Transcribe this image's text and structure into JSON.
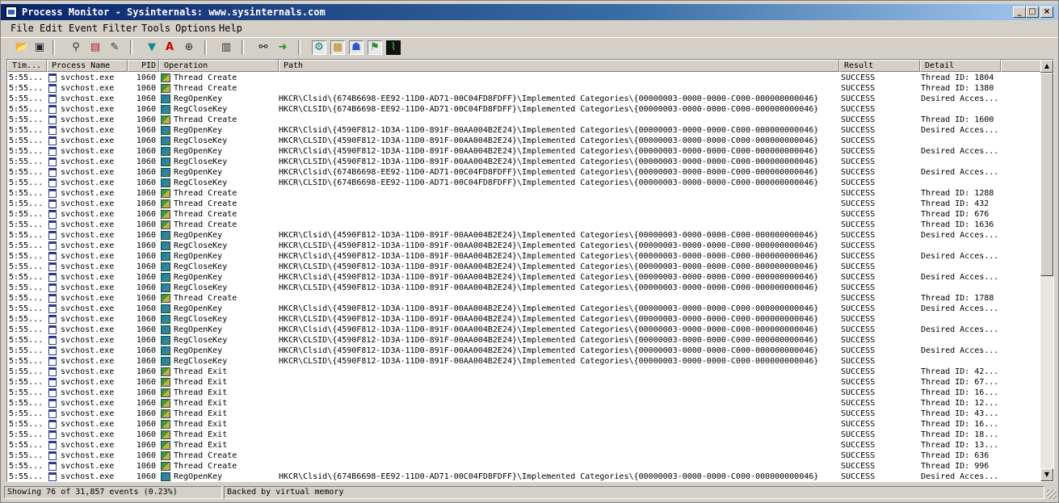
{
  "window": {
    "title": "Process Monitor - Sysinternals: www.sysinternals.com"
  },
  "menu": [
    "File",
    "Edit",
    "Event",
    "Filter",
    "Tools",
    "Options",
    "Help"
  ],
  "toolbar": {
    "icons": [
      "open-icon",
      "save-icon",
      "magnifier-icon",
      "autoscroll-icon",
      "clear-icon",
      "filter-icon",
      "highlight-icon",
      "target-icon",
      "properties-icon",
      "find-icon",
      "jump-icon",
      "show-registry-icon",
      "show-filesystem-icon",
      "show-network-icon",
      "show-process-icon",
      "show-profiling-icon"
    ]
  },
  "columns": [
    "Tim...",
    "Process Name",
    "PID",
    "Operation",
    "Path",
    "Result",
    "Detail"
  ],
  "rows": [
    {
      "time": "5:55...",
      "proc": "svchost.exe",
      "pid": "1060",
      "type": "thr",
      "op": "Thread Create",
      "path": "",
      "result": "SUCCESS",
      "detail": "Thread ID: 1804"
    },
    {
      "time": "5:55...",
      "proc": "svchost.exe",
      "pid": "1060",
      "type": "thr",
      "op": "Thread Create",
      "path": "",
      "result": "SUCCESS",
      "detail": "Thread ID: 1380"
    },
    {
      "time": "5:55...",
      "proc": "svchost.exe",
      "pid": "1060",
      "type": "reg",
      "op": "RegOpenKey",
      "path": "HKCR\\Clsid\\{674B6698-EE92-11D0-AD71-00C04FD8FDFF}\\Implemented Categories\\{00000003-0000-0000-C000-000000000046}",
      "result": "SUCCESS",
      "detail": "Desired Acces..."
    },
    {
      "time": "5:55...",
      "proc": "svchost.exe",
      "pid": "1060",
      "type": "reg",
      "op": "RegCloseKey",
      "path": "HKCR\\CLSID\\{674B6698-EE92-11D0-AD71-00C04FD8FDFF}\\Implemented Categories\\{00000003-0000-0000-C000-000000000046}",
      "result": "SUCCESS",
      "detail": ""
    },
    {
      "time": "5:55...",
      "proc": "svchost.exe",
      "pid": "1060",
      "type": "thr",
      "op": "Thread Create",
      "path": "",
      "result": "SUCCESS",
      "detail": "Thread ID: 1600"
    },
    {
      "time": "5:55...",
      "proc": "svchost.exe",
      "pid": "1060",
      "type": "reg",
      "op": "RegOpenKey",
      "path": "HKCR\\Clsid\\{4590F812-1D3A-11D0-891F-00AA004B2E24}\\Implemented Categories\\{00000003-0000-0000-C000-000000000046}",
      "result": "SUCCESS",
      "detail": "Desired Acces..."
    },
    {
      "time": "5:55...",
      "proc": "svchost.exe",
      "pid": "1060",
      "type": "reg",
      "op": "RegCloseKey",
      "path": "HKCR\\CLSID\\{4590F812-1D3A-11D0-891F-00AA004B2E24}\\Implemented Categories\\{00000003-0000-0000-C000-000000000046}",
      "result": "SUCCESS",
      "detail": ""
    },
    {
      "time": "5:55...",
      "proc": "svchost.exe",
      "pid": "1060",
      "type": "reg",
      "op": "RegOpenKey",
      "path": "HKCR\\Clsid\\{4590F812-1D3A-11D0-891F-00AA004B2E24}\\Implemented Categories\\{00000003-0000-0000-C000-000000000046}",
      "result": "SUCCESS",
      "detail": "Desired Acces..."
    },
    {
      "time": "5:55...",
      "proc": "svchost.exe",
      "pid": "1060",
      "type": "reg",
      "op": "RegCloseKey",
      "path": "HKCR\\CLSID\\{4590F812-1D3A-11D0-891F-00AA004B2E24}\\Implemented Categories\\{00000003-0000-0000-C000-000000000046}",
      "result": "SUCCESS",
      "detail": ""
    },
    {
      "time": "5:55...",
      "proc": "svchost.exe",
      "pid": "1060",
      "type": "reg",
      "op": "RegOpenKey",
      "path": "HKCR\\Clsid\\{674B6698-EE92-11D0-AD71-00C04FD8FDFF}\\Implemented Categories\\{00000003-0000-0000-C000-000000000046}",
      "result": "SUCCESS",
      "detail": "Desired Acces..."
    },
    {
      "time": "5:55...",
      "proc": "svchost.exe",
      "pid": "1060",
      "type": "reg",
      "op": "RegCloseKey",
      "path": "HKCR\\CLSID\\{674B6698-EE92-11D0-AD71-00C04FD8FDFF}\\Implemented Categories\\{00000003-0000-0000-C000-000000000046}",
      "result": "SUCCESS",
      "detail": ""
    },
    {
      "time": "5:55...",
      "proc": "svchost.exe",
      "pid": "1060",
      "type": "thr",
      "op": "Thread Create",
      "path": "",
      "result": "SUCCESS",
      "detail": "Thread ID: 1288"
    },
    {
      "time": "5:55...",
      "proc": "svchost.exe",
      "pid": "1060",
      "type": "thr",
      "op": "Thread Create",
      "path": "",
      "result": "SUCCESS",
      "detail": "Thread ID: 432"
    },
    {
      "time": "5:55...",
      "proc": "svchost.exe",
      "pid": "1060",
      "type": "thr",
      "op": "Thread Create",
      "path": "",
      "result": "SUCCESS",
      "detail": "Thread ID: 676"
    },
    {
      "time": "5:55...",
      "proc": "svchost.exe",
      "pid": "1060",
      "type": "thr",
      "op": "Thread Create",
      "path": "",
      "result": "SUCCESS",
      "detail": "Thread ID: 1636"
    },
    {
      "time": "5:55...",
      "proc": "svchost.exe",
      "pid": "1060",
      "type": "reg",
      "op": "RegOpenKey",
      "path": "HKCR\\Clsid\\{4590F812-1D3A-11D0-891F-00AA004B2E24}\\Implemented Categories\\{00000003-0000-0000-C000-000000000046}",
      "result": "SUCCESS",
      "detail": "Desired Acces..."
    },
    {
      "time": "5:55...",
      "proc": "svchost.exe",
      "pid": "1060",
      "type": "reg",
      "op": "RegCloseKey",
      "path": "HKCR\\CLSID\\{4590F812-1D3A-11D0-891F-00AA004B2E24}\\Implemented Categories\\{00000003-0000-0000-C000-000000000046}",
      "result": "SUCCESS",
      "detail": ""
    },
    {
      "time": "5:55...",
      "proc": "svchost.exe",
      "pid": "1060",
      "type": "reg",
      "op": "RegOpenKey",
      "path": "HKCR\\Clsid\\{4590F812-1D3A-11D0-891F-00AA004B2E24}\\Implemented Categories\\{00000003-0000-0000-C000-000000000046}",
      "result": "SUCCESS",
      "detail": "Desired Acces..."
    },
    {
      "time": "5:55...",
      "proc": "svchost.exe",
      "pid": "1060",
      "type": "reg",
      "op": "RegCloseKey",
      "path": "HKCR\\CLSID\\{4590F812-1D3A-11D0-891F-00AA004B2E24}\\Implemented Categories\\{00000003-0000-0000-C000-000000000046}",
      "result": "SUCCESS",
      "detail": ""
    },
    {
      "time": "5:55...",
      "proc": "svchost.exe",
      "pid": "1060",
      "type": "reg",
      "op": "RegOpenKey",
      "path": "HKCR\\Clsid\\{4590F812-1D3A-11D0-891F-00AA004B2E24}\\Implemented Categories\\{00000003-0000-0000-C000-000000000046}",
      "result": "SUCCESS",
      "detail": "Desired Acces..."
    },
    {
      "time": "5:55...",
      "proc": "svchost.exe",
      "pid": "1060",
      "type": "reg",
      "op": "RegCloseKey",
      "path": "HKCR\\CLSID\\{4590F812-1D3A-11D0-891F-00AA004B2E24}\\Implemented Categories\\{00000003-0000-0000-C000-000000000046}",
      "result": "SUCCESS",
      "detail": ""
    },
    {
      "time": "5:55...",
      "proc": "svchost.exe",
      "pid": "1060",
      "type": "thr",
      "op": "Thread Create",
      "path": "",
      "result": "SUCCESS",
      "detail": "Thread ID: 1788"
    },
    {
      "time": "5:55...",
      "proc": "svchost.exe",
      "pid": "1060",
      "type": "reg",
      "op": "RegOpenKey",
      "path": "HKCR\\Clsid\\{4590F812-1D3A-11D0-891F-00AA004B2E24}\\Implemented Categories\\{00000003-0000-0000-C000-000000000046}",
      "result": "SUCCESS",
      "detail": "Desired Acces..."
    },
    {
      "time": "5:55...",
      "proc": "svchost.exe",
      "pid": "1060",
      "type": "reg",
      "op": "RegCloseKey",
      "path": "HKCR\\CLSID\\{4590F812-1D3A-11D0-891F-00AA004B2E24}\\Implemented Categories\\{00000003-0000-0000-C000-000000000046}",
      "result": "SUCCESS",
      "detail": ""
    },
    {
      "time": "5:55...",
      "proc": "svchost.exe",
      "pid": "1060",
      "type": "reg",
      "op": "RegOpenKey",
      "path": "HKCR\\Clsid\\{4590F812-1D3A-11D0-891F-00AA004B2E24}\\Implemented Categories\\{00000003-0000-0000-C000-000000000046}",
      "result": "SUCCESS",
      "detail": "Desired Acces..."
    },
    {
      "time": "5:55...",
      "proc": "svchost.exe",
      "pid": "1060",
      "type": "reg",
      "op": "RegCloseKey",
      "path": "HKCR\\CLSID\\{4590F812-1D3A-11D0-891F-00AA004B2E24}\\Implemented Categories\\{00000003-0000-0000-C000-000000000046}",
      "result": "SUCCESS",
      "detail": ""
    },
    {
      "time": "5:55...",
      "proc": "svchost.exe",
      "pid": "1060",
      "type": "reg",
      "op": "RegOpenKey",
      "path": "HKCR\\Clsid\\{4590F812-1D3A-11D0-891F-00AA004B2E24}\\Implemented Categories\\{00000003-0000-0000-C000-000000000046}",
      "result": "SUCCESS",
      "detail": "Desired Acces..."
    },
    {
      "time": "5:55...",
      "proc": "svchost.exe",
      "pid": "1060",
      "type": "reg",
      "op": "RegCloseKey",
      "path": "HKCR\\CLSID\\{4590F812-1D3A-11D0-891F-00AA004B2E24}\\Implemented Categories\\{00000003-0000-0000-C000-000000000046}",
      "result": "SUCCESS",
      "detail": ""
    },
    {
      "time": "5:55...",
      "proc": "svchost.exe",
      "pid": "1060",
      "type": "thr",
      "op": "Thread Exit",
      "path": "",
      "result": "SUCCESS",
      "detail": "Thread ID: 42..."
    },
    {
      "time": "5:55...",
      "proc": "svchost.exe",
      "pid": "1060",
      "type": "thr",
      "op": "Thread Exit",
      "path": "",
      "result": "SUCCESS",
      "detail": "Thread ID: 67..."
    },
    {
      "time": "5:55...",
      "proc": "svchost.exe",
      "pid": "1060",
      "type": "thr",
      "op": "Thread Exit",
      "path": "",
      "result": "SUCCESS",
      "detail": "Thread ID: 16..."
    },
    {
      "time": "5:55...",
      "proc": "svchost.exe",
      "pid": "1060",
      "type": "thr",
      "op": "Thread Exit",
      "path": "",
      "result": "SUCCESS",
      "detail": "Thread ID: 12..."
    },
    {
      "time": "5:55...",
      "proc": "svchost.exe",
      "pid": "1060",
      "type": "thr",
      "op": "Thread Exit",
      "path": "",
      "result": "SUCCESS",
      "detail": "Thread ID: 43..."
    },
    {
      "time": "5:55...",
      "proc": "svchost.exe",
      "pid": "1060",
      "type": "thr",
      "op": "Thread Exit",
      "path": "",
      "result": "SUCCESS",
      "detail": "Thread ID: 16..."
    },
    {
      "time": "5:55...",
      "proc": "svchost.exe",
      "pid": "1060",
      "type": "thr",
      "op": "Thread Exit",
      "path": "",
      "result": "SUCCESS",
      "detail": "Thread ID: 18..."
    },
    {
      "time": "5:55...",
      "proc": "svchost.exe",
      "pid": "1060",
      "type": "thr",
      "op": "Thread Exit",
      "path": "",
      "result": "SUCCESS",
      "detail": "Thread ID: 13..."
    },
    {
      "time": "5:55...",
      "proc": "svchost.exe",
      "pid": "1060",
      "type": "thr",
      "op": "Thread Create",
      "path": "",
      "result": "SUCCESS",
      "detail": "Thread ID: 636"
    },
    {
      "time": "5:55...",
      "proc": "svchost.exe",
      "pid": "1060",
      "type": "thr",
      "op": "Thread Create",
      "path": "",
      "result": "SUCCESS",
      "detail": "Thread ID: 996"
    },
    {
      "time": "5:55...",
      "proc": "svchost.exe",
      "pid": "1060",
      "type": "reg",
      "op": "RegOpenKey",
      "path": "HKCR\\Clsid\\{674B6698-EE92-11D0-AD71-00C04FD8FDFF}\\Implemented Categories\\{00000003-0000-0000-C000-000000000046}",
      "result": "SUCCESS",
      "detail": "Desired Acces..."
    }
  ],
  "status": {
    "events": "Showing 76 of 31,857 events (0.23%)",
    "memory": "Backed by virtual memory"
  }
}
